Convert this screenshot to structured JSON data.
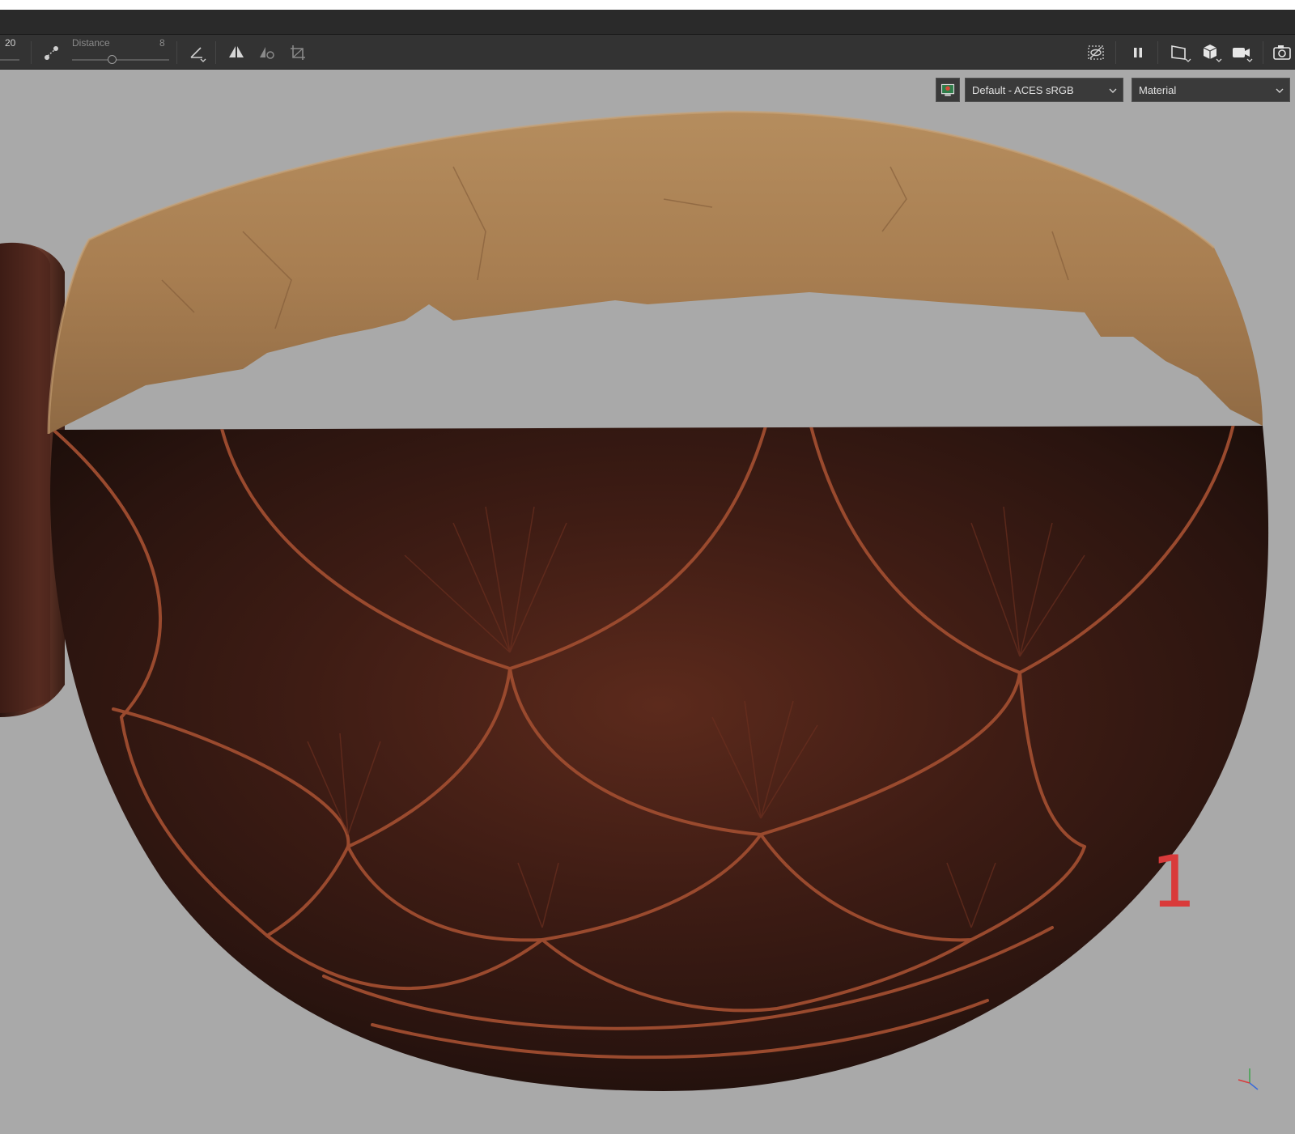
{
  "toolbar": {
    "size_value": "20",
    "distance_label": "Distance",
    "distance_value": "8",
    "icons": [
      "brush-spacing-icon",
      "lazy-mouse-icon",
      "symmetry-icon",
      "mirror-icon",
      "transform-icon",
      "hide-ui-icon",
      "pause-icon",
      "perspective-icon",
      "cube-view-icon",
      "camera-icon",
      "screenshot-icon"
    ]
  },
  "viewport": {
    "colorspace": "Default - ACES sRGB",
    "shading_mode": "Material",
    "annotation": "1",
    "background_color": "#a9a9a9",
    "annotation_color": "#d93a3a"
  }
}
